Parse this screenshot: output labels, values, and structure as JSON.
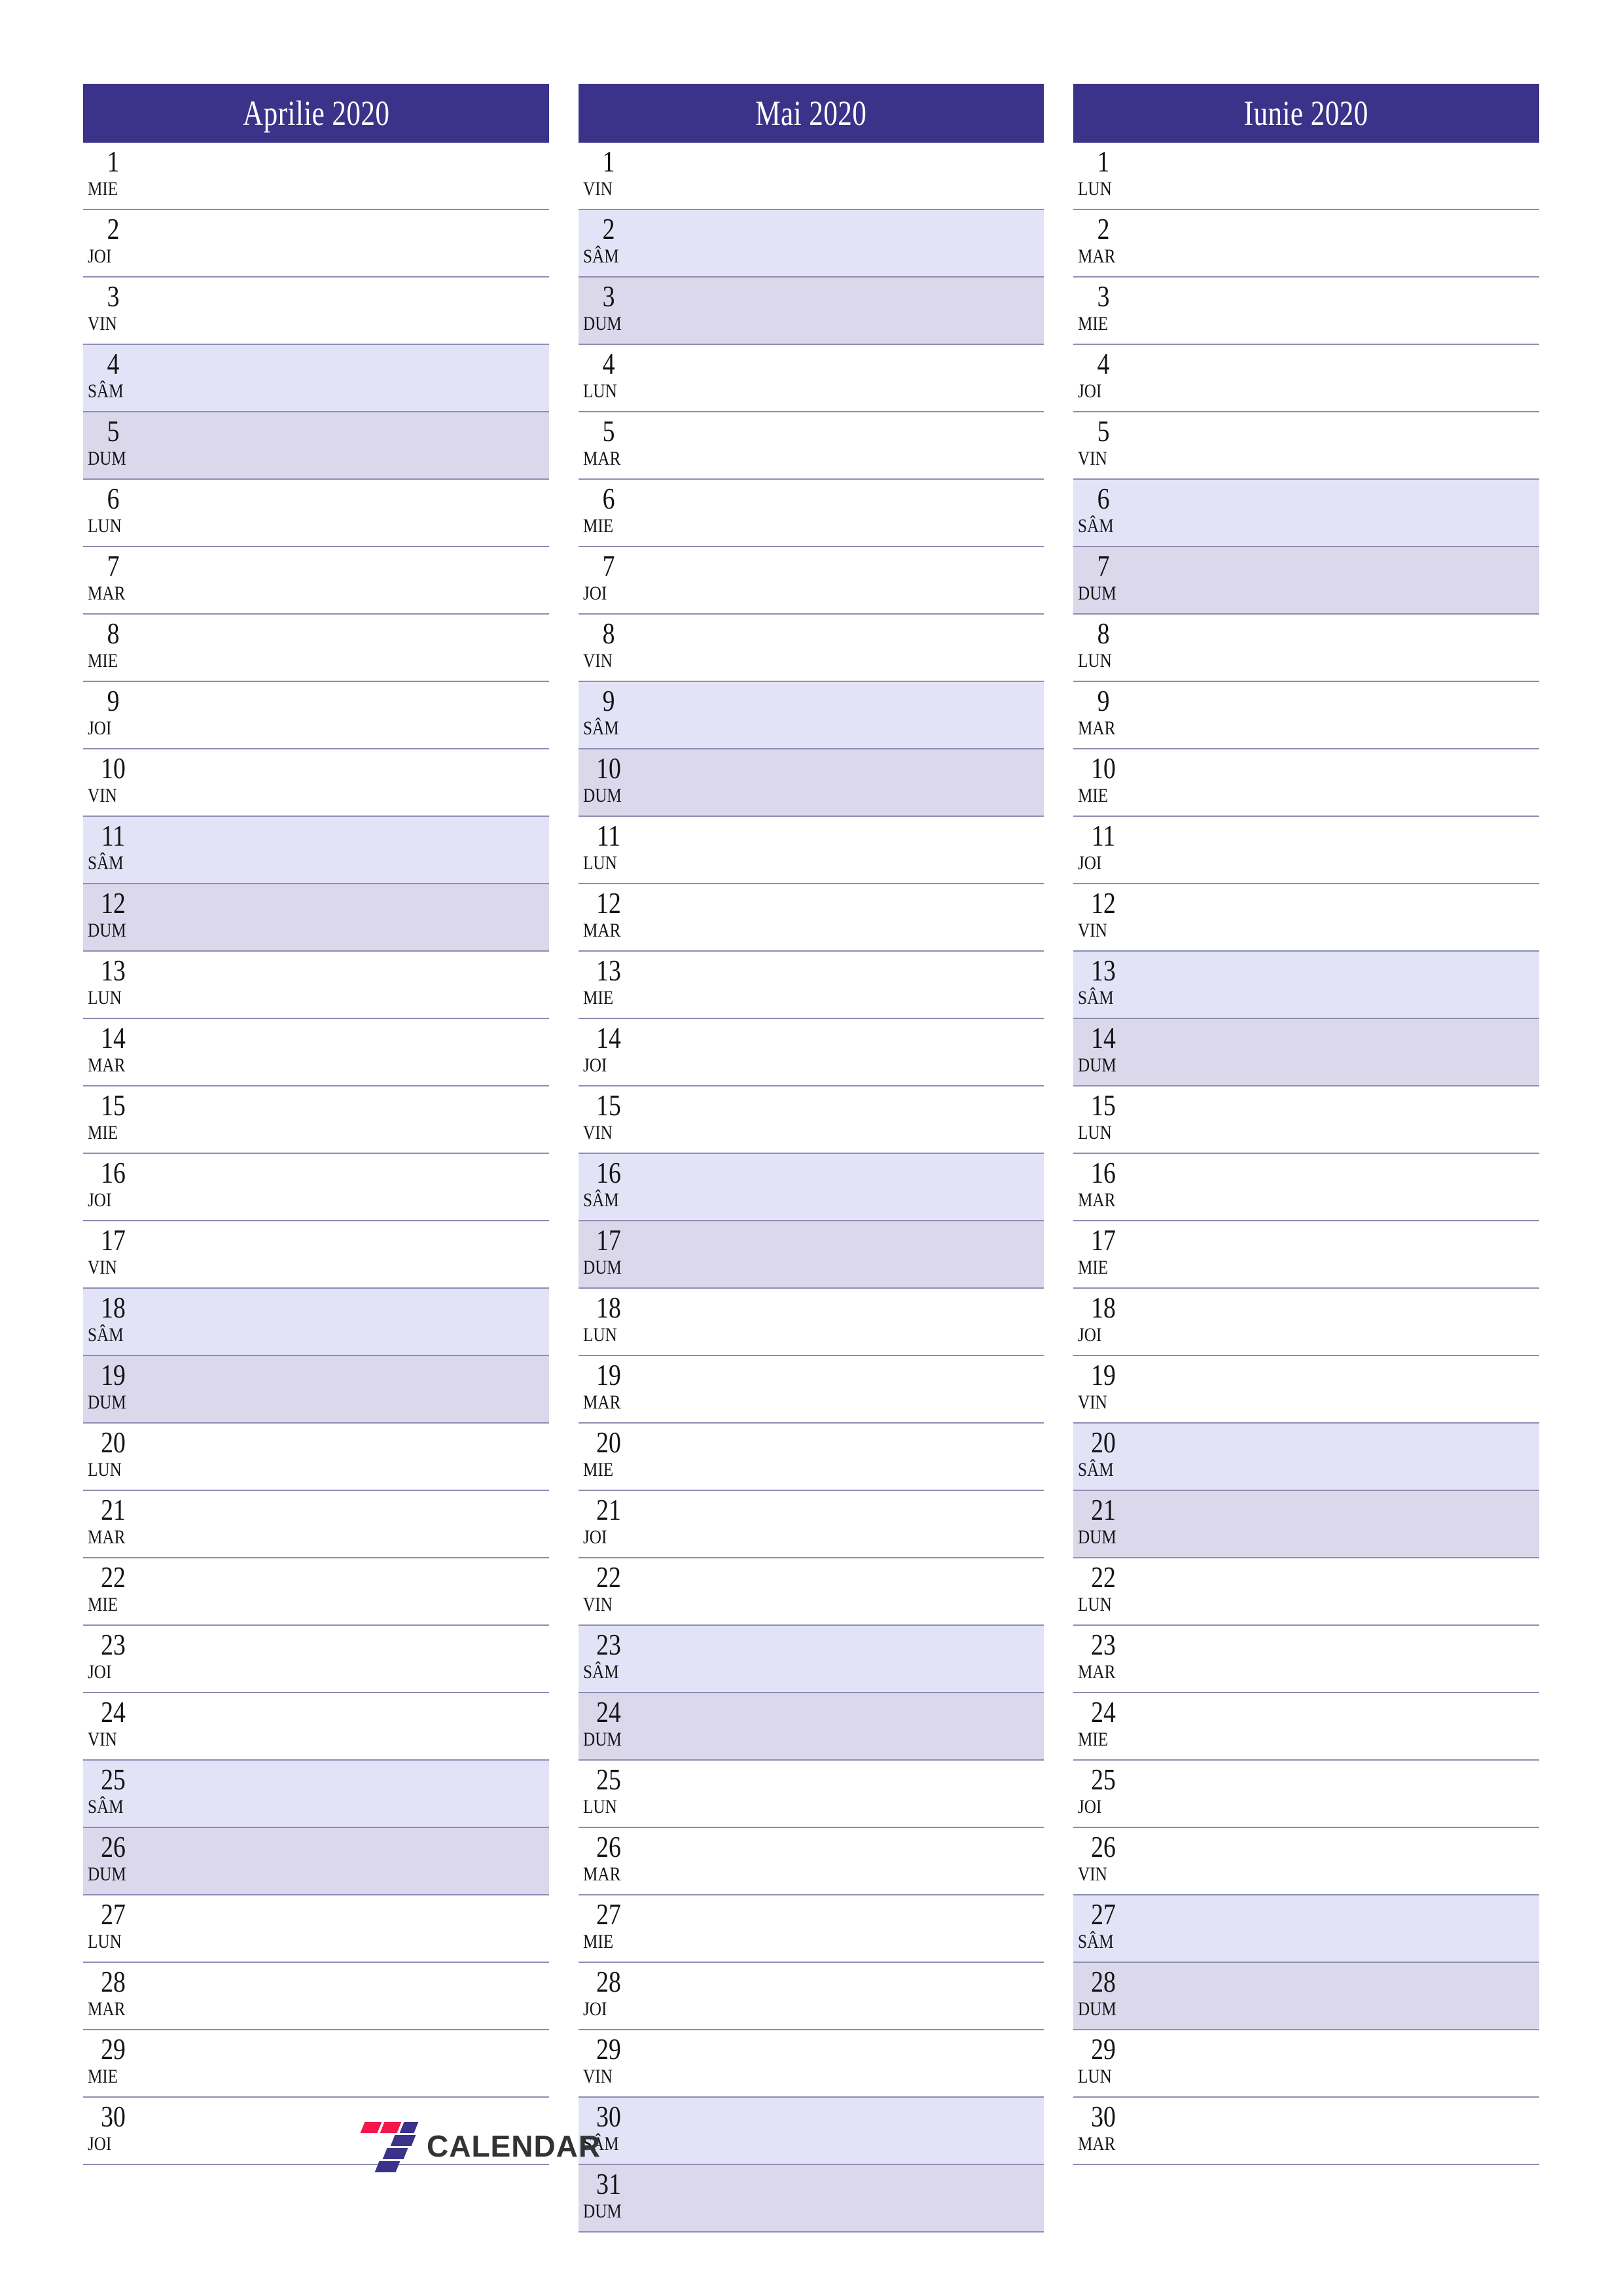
{
  "document": {
    "type": "quarterly-planner",
    "year": "2020",
    "locale": "ro"
  },
  "colors": {
    "header_bg": "#3b3289",
    "header_text": "#ffffff",
    "row_divider": "#8f8cb4",
    "saturday_bg": "#e3e3f7",
    "sunday_bg": "#dbd8ec",
    "weekday_bg": "#ffffff",
    "day_text": "#131313",
    "logo_red": "#f4174a",
    "logo_blue": "#3b3289",
    "logo_word": "#333333"
  },
  "footer": {
    "logo_mark_name": "seven-logo-mark",
    "logo_text": "CALENDAR"
  },
  "months": [
    {
      "title": "Aprilie 2020",
      "name": "Aprilie",
      "days": [
        {
          "num": "1",
          "dow": "MIE",
          "kind": "weekday"
        },
        {
          "num": "2",
          "dow": "JOI",
          "kind": "weekday"
        },
        {
          "num": "3",
          "dow": "VIN",
          "kind": "weekday"
        },
        {
          "num": "4",
          "dow": "SÂM",
          "kind": "sat"
        },
        {
          "num": "5",
          "dow": "DUM",
          "kind": "sun"
        },
        {
          "num": "6",
          "dow": "LUN",
          "kind": "weekday"
        },
        {
          "num": "7",
          "dow": "MAR",
          "kind": "weekday"
        },
        {
          "num": "8",
          "dow": "MIE",
          "kind": "weekday"
        },
        {
          "num": "9",
          "dow": "JOI",
          "kind": "weekday"
        },
        {
          "num": "10",
          "dow": "VIN",
          "kind": "weekday"
        },
        {
          "num": "11",
          "dow": "SÂM",
          "kind": "sat"
        },
        {
          "num": "12",
          "dow": "DUM",
          "kind": "sun"
        },
        {
          "num": "13",
          "dow": "LUN",
          "kind": "weekday"
        },
        {
          "num": "14",
          "dow": "MAR",
          "kind": "weekday"
        },
        {
          "num": "15",
          "dow": "MIE",
          "kind": "weekday"
        },
        {
          "num": "16",
          "dow": "JOI",
          "kind": "weekday"
        },
        {
          "num": "17",
          "dow": "VIN",
          "kind": "weekday"
        },
        {
          "num": "18",
          "dow": "SÂM",
          "kind": "sat"
        },
        {
          "num": "19",
          "dow": "DUM",
          "kind": "sun"
        },
        {
          "num": "20",
          "dow": "LUN",
          "kind": "weekday"
        },
        {
          "num": "21",
          "dow": "MAR",
          "kind": "weekday"
        },
        {
          "num": "22",
          "dow": "MIE",
          "kind": "weekday"
        },
        {
          "num": "23",
          "dow": "JOI",
          "kind": "weekday"
        },
        {
          "num": "24",
          "dow": "VIN",
          "kind": "weekday"
        },
        {
          "num": "25",
          "dow": "SÂM",
          "kind": "sat"
        },
        {
          "num": "26",
          "dow": "DUM",
          "kind": "sun"
        },
        {
          "num": "27",
          "dow": "LUN",
          "kind": "weekday"
        },
        {
          "num": "28",
          "dow": "MAR",
          "kind": "weekday"
        },
        {
          "num": "29",
          "dow": "MIE",
          "kind": "weekday"
        },
        {
          "num": "30",
          "dow": "JOI",
          "kind": "weekday"
        }
      ]
    },
    {
      "title": "Mai 2020",
      "name": "Mai",
      "days": [
        {
          "num": "1",
          "dow": "VIN",
          "kind": "weekday"
        },
        {
          "num": "2",
          "dow": "SÂM",
          "kind": "sat"
        },
        {
          "num": "3",
          "dow": "DUM",
          "kind": "sun"
        },
        {
          "num": "4",
          "dow": "LUN",
          "kind": "weekday"
        },
        {
          "num": "5",
          "dow": "MAR",
          "kind": "weekday"
        },
        {
          "num": "6",
          "dow": "MIE",
          "kind": "weekday"
        },
        {
          "num": "7",
          "dow": "JOI",
          "kind": "weekday"
        },
        {
          "num": "8",
          "dow": "VIN",
          "kind": "weekday"
        },
        {
          "num": "9",
          "dow": "SÂM",
          "kind": "sat"
        },
        {
          "num": "10",
          "dow": "DUM",
          "kind": "sun"
        },
        {
          "num": "11",
          "dow": "LUN",
          "kind": "weekday"
        },
        {
          "num": "12",
          "dow": "MAR",
          "kind": "weekday"
        },
        {
          "num": "13",
          "dow": "MIE",
          "kind": "weekday"
        },
        {
          "num": "14",
          "dow": "JOI",
          "kind": "weekday"
        },
        {
          "num": "15",
          "dow": "VIN",
          "kind": "weekday"
        },
        {
          "num": "16",
          "dow": "SÂM",
          "kind": "sat"
        },
        {
          "num": "17",
          "dow": "DUM",
          "kind": "sun"
        },
        {
          "num": "18",
          "dow": "LUN",
          "kind": "weekday"
        },
        {
          "num": "19",
          "dow": "MAR",
          "kind": "weekday"
        },
        {
          "num": "20",
          "dow": "MIE",
          "kind": "weekday"
        },
        {
          "num": "21",
          "dow": "JOI",
          "kind": "weekday"
        },
        {
          "num": "22",
          "dow": "VIN",
          "kind": "weekday"
        },
        {
          "num": "23",
          "dow": "SÂM",
          "kind": "sat"
        },
        {
          "num": "24",
          "dow": "DUM",
          "kind": "sun"
        },
        {
          "num": "25",
          "dow": "LUN",
          "kind": "weekday"
        },
        {
          "num": "26",
          "dow": "MAR",
          "kind": "weekday"
        },
        {
          "num": "27",
          "dow": "MIE",
          "kind": "weekday"
        },
        {
          "num": "28",
          "dow": "JOI",
          "kind": "weekday"
        },
        {
          "num": "29",
          "dow": "VIN",
          "kind": "weekday"
        },
        {
          "num": "30",
          "dow": "SÂM",
          "kind": "sat"
        },
        {
          "num": "31",
          "dow": "DUM",
          "kind": "sun"
        }
      ]
    },
    {
      "title": "Iunie 2020",
      "name": "Iunie",
      "days": [
        {
          "num": "1",
          "dow": "LUN",
          "kind": "weekday"
        },
        {
          "num": "2",
          "dow": "MAR",
          "kind": "weekday"
        },
        {
          "num": "3",
          "dow": "MIE",
          "kind": "weekday"
        },
        {
          "num": "4",
          "dow": "JOI",
          "kind": "weekday"
        },
        {
          "num": "5",
          "dow": "VIN",
          "kind": "weekday"
        },
        {
          "num": "6",
          "dow": "SÂM",
          "kind": "sat"
        },
        {
          "num": "7",
          "dow": "DUM",
          "kind": "sun"
        },
        {
          "num": "8",
          "dow": "LUN",
          "kind": "weekday"
        },
        {
          "num": "9",
          "dow": "MAR",
          "kind": "weekday"
        },
        {
          "num": "10",
          "dow": "MIE",
          "kind": "weekday"
        },
        {
          "num": "11",
          "dow": "JOI",
          "kind": "weekday"
        },
        {
          "num": "12",
          "dow": "VIN",
          "kind": "weekday"
        },
        {
          "num": "13",
          "dow": "SÂM",
          "kind": "sat"
        },
        {
          "num": "14",
          "dow": "DUM",
          "kind": "sun"
        },
        {
          "num": "15",
          "dow": "LUN",
          "kind": "weekday"
        },
        {
          "num": "16",
          "dow": "MAR",
          "kind": "weekday"
        },
        {
          "num": "17",
          "dow": "MIE",
          "kind": "weekday"
        },
        {
          "num": "18",
          "dow": "JOI",
          "kind": "weekday"
        },
        {
          "num": "19",
          "dow": "VIN",
          "kind": "weekday"
        },
        {
          "num": "20",
          "dow": "SÂM",
          "kind": "sat"
        },
        {
          "num": "21",
          "dow": "DUM",
          "kind": "sun"
        },
        {
          "num": "22",
          "dow": "LUN",
          "kind": "weekday"
        },
        {
          "num": "23",
          "dow": "MAR",
          "kind": "weekday"
        },
        {
          "num": "24",
          "dow": "MIE",
          "kind": "weekday"
        },
        {
          "num": "25",
          "dow": "JOI",
          "kind": "weekday"
        },
        {
          "num": "26",
          "dow": "VIN",
          "kind": "weekday"
        },
        {
          "num": "27",
          "dow": "SÂM",
          "kind": "sat"
        },
        {
          "num": "28",
          "dow": "DUM",
          "kind": "sun"
        },
        {
          "num": "29",
          "dow": "LUN",
          "kind": "weekday"
        },
        {
          "num": "30",
          "dow": "MAR",
          "kind": "weekday"
        }
      ]
    }
  ]
}
